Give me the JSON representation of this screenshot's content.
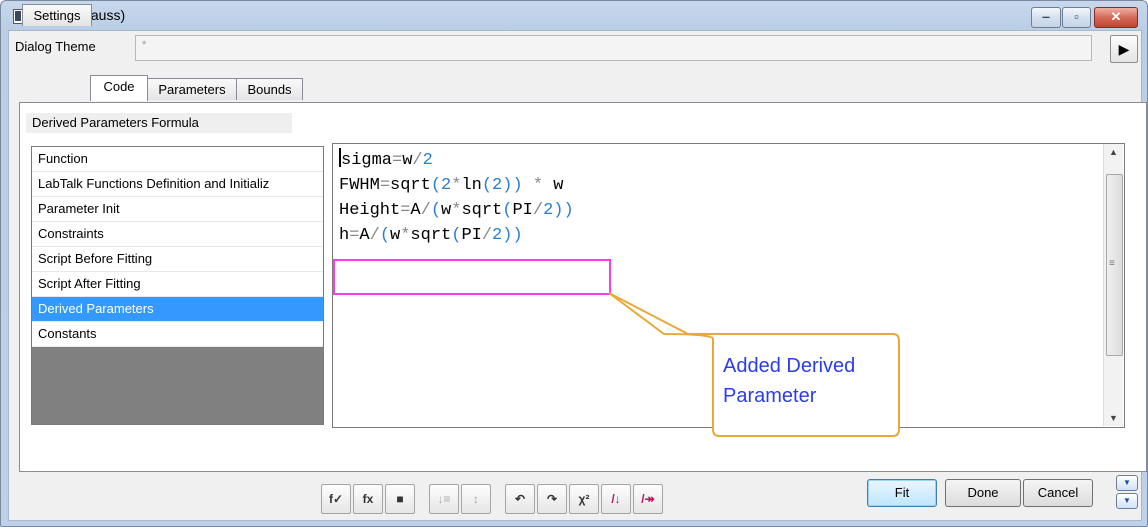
{
  "window": {
    "title": "NLFit (Gauss)",
    "controls": [
      "minimize-icon",
      "maximize-icon",
      "close-icon"
    ]
  },
  "theme": {
    "label": "Dialog Theme",
    "value": "*",
    "arrow": "▶"
  },
  "tabs": [
    {
      "label": "Settings",
      "active": false
    },
    {
      "label": "Code",
      "active": true
    },
    {
      "label": "Parameters",
      "active": false
    },
    {
      "label": "Bounds",
      "active": false
    }
  ],
  "section_label": "Derived Parameters Formula",
  "list": {
    "items": [
      "Function",
      "LabTalk Functions Definition and Initializ",
      "Parameter Init",
      "Constraints",
      "Script Before Fitting",
      "Script After Fitting",
      "Derived Parameters",
      "Constants"
    ],
    "selected": "Derived Parameters"
  },
  "code_lines": [
    "sigma=w/2",
    "FWHM=sqrt(2*ln(2)) * w",
    "Height=A/(w*sqrt(PI/2))",
    "h=A/(w*sqrt(PI/2))"
  ],
  "callout": {
    "line1": "Added Derived",
    "line2": "Parameter"
  },
  "toolbar_icons": [
    "compile-icon",
    "function-icon",
    "save-icon",
    "sort-down-icon",
    "sort-up-icon",
    "undo-icon",
    "redo-icon",
    "chi-square-icon",
    "fit-one-icon",
    "fit-until-converge-icon"
  ],
  "buttons": {
    "fit": "Fit",
    "done": "Done",
    "cancel": "Cancel"
  },
  "colors": {
    "selection": "#3399ff",
    "highlight_box": "#ff3ae6",
    "callout_text": "#2b3cf0",
    "callout_border": "#e8a93a"
  }
}
